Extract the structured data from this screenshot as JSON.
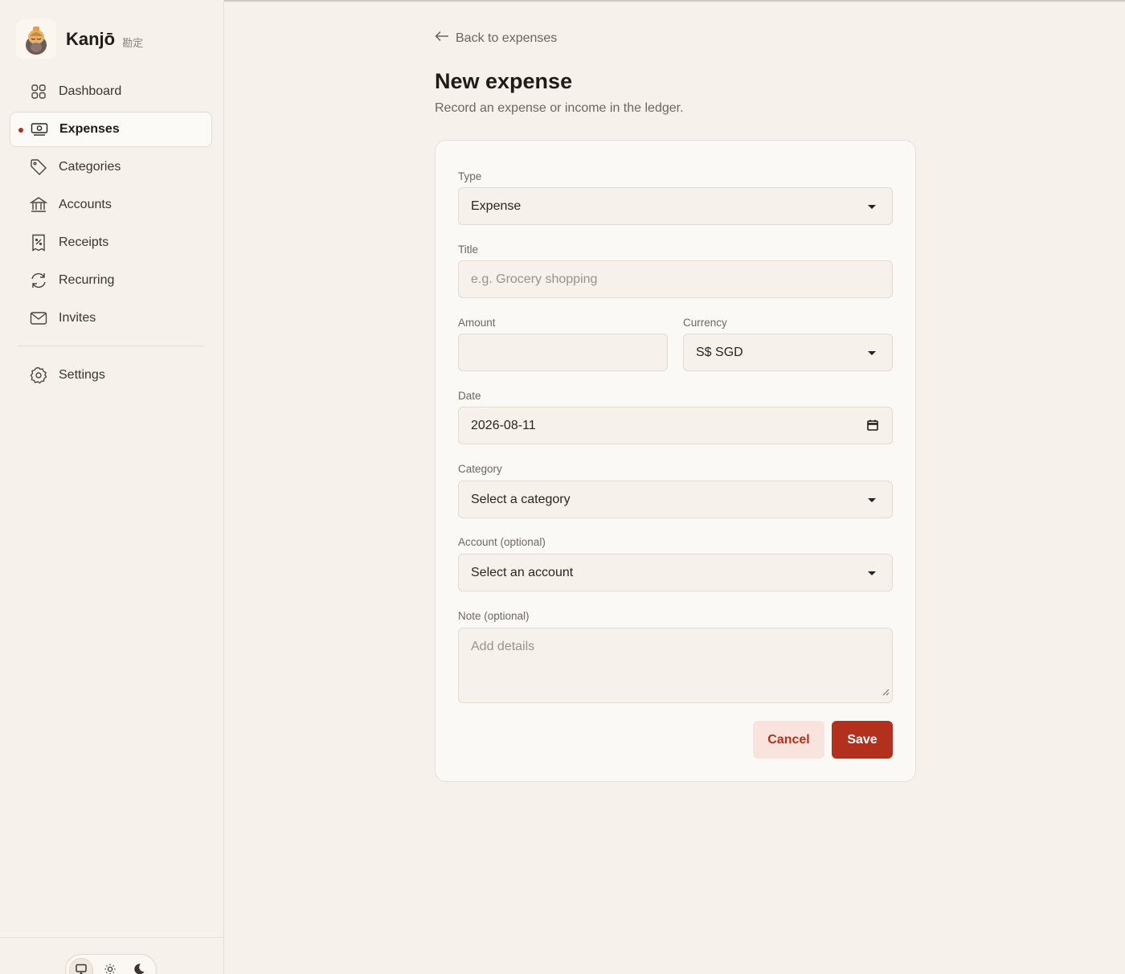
{
  "app": {
    "name": "Kanjō",
    "subtitle": "勘定"
  },
  "sidebar": {
    "items": [
      {
        "label": "Dashboard",
        "icon": "grid-icon"
      },
      {
        "label": "Expenses",
        "icon": "banknote-icon",
        "active": true
      },
      {
        "label": "Categories",
        "icon": "tag-icon"
      },
      {
        "label": "Accounts",
        "icon": "bank-icon"
      },
      {
        "label": "Receipts",
        "icon": "receipt-icon"
      },
      {
        "label": "Recurring",
        "icon": "refresh-icon"
      },
      {
        "label": "Invites",
        "icon": "mail-icon"
      }
    ],
    "settings": {
      "label": "Settings",
      "icon": "gear-icon"
    },
    "theme_options": [
      "monitor-icon",
      "sun-icon",
      "moon-icon"
    ],
    "theme_selected": "monitor-icon"
  },
  "header": {
    "back_label": "Back to expenses",
    "title": "New expense",
    "subtitle": "Record an expense or income in the ledger."
  },
  "form": {
    "type": {
      "label": "Type",
      "value": "Expense"
    },
    "title": {
      "label": "Title",
      "placeholder": "e.g. Grocery shopping",
      "value": ""
    },
    "amount": {
      "label": "Amount",
      "value": ""
    },
    "currency": {
      "label": "Currency",
      "value": "S$ SGD"
    },
    "date": {
      "label": "Date",
      "value": "2026-08-11"
    },
    "category": {
      "label": "Category",
      "value": "Select a category"
    },
    "account": {
      "label": "Account (optional)",
      "value": "Select an account"
    },
    "note": {
      "label": "Note (optional)",
      "placeholder": "Add details",
      "value": ""
    },
    "cancel_label": "Cancel",
    "save_label": "Save"
  },
  "colors": {
    "accent": "#b3301d",
    "background": "#f6f1ea",
    "card": "#fbf9f6"
  }
}
